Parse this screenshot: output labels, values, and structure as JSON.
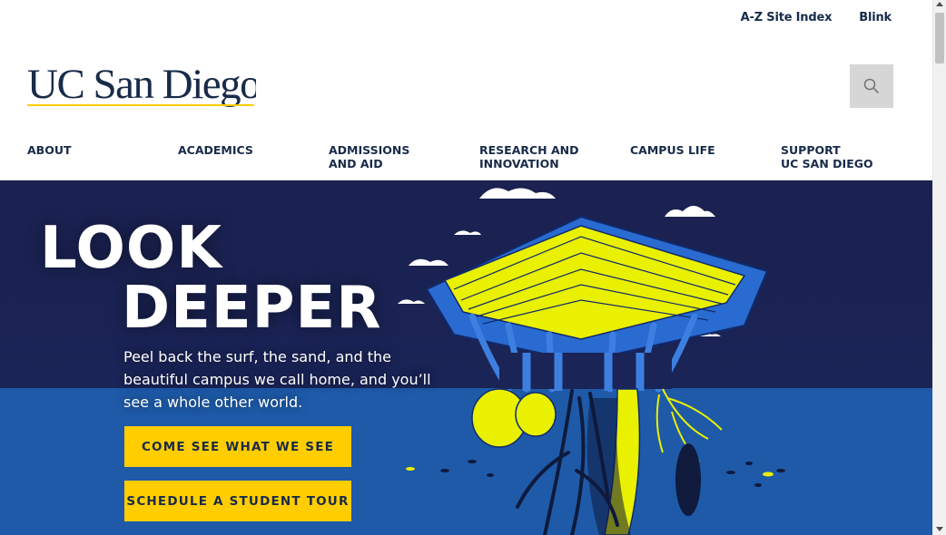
{
  "utility_links": [
    "A-Z Site Index",
    "Blink"
  ],
  "logo": {
    "text": "UC San Diego",
    "colors": {
      "text": "#182b49",
      "underline": "#ffcd00"
    }
  },
  "search": {
    "icon": "search-icon"
  },
  "nav": [
    {
      "line1": "About",
      "line2": ""
    },
    {
      "line1": "Academics",
      "line2": ""
    },
    {
      "line1": "Admissions",
      "line2": "and Aid"
    },
    {
      "line1": "Research and",
      "line2": "Innovation"
    },
    {
      "line1": "Campus Life",
      "line2": ""
    },
    {
      "line1": "Support",
      "line2": "UC San Diego"
    }
  ],
  "hero": {
    "headline_line1": "LOOK",
    "headline_line2": "DEEPER",
    "description": "Peel back the surf, the sand, and the beautiful campus we call home, and you’ll see a whole other world.",
    "cta_primary": "Come see what we see",
    "cta_secondary": "Schedule a student tour",
    "colors": {
      "navy": "#1a2456",
      "ocean": "#1e5aa8",
      "gold": "#ffcd00"
    }
  }
}
